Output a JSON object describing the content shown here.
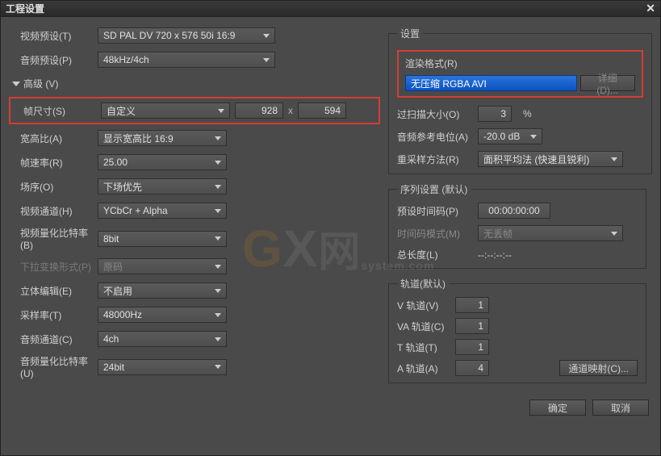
{
  "window": {
    "title": "工程设置"
  },
  "left": {
    "videoPreset": {
      "label": "视频预设(T)",
      "value": "SD PAL DV 720 x 576 50i 16:9"
    },
    "audioPreset": {
      "label": "音频预设(P)",
      "value": "48kHz/4ch"
    },
    "advanced": {
      "label": "高级 (V)"
    },
    "frameSize": {
      "label": "帧尺寸(S)",
      "value": "自定义",
      "w": "928",
      "sep": "x",
      "h": "594"
    },
    "aspect": {
      "label": "宽高比(A)",
      "value": "显示宽高比 16:9"
    },
    "frameRate": {
      "label": "帧速率(R)",
      "value": "25.00"
    },
    "fieldOrder": {
      "label": "场序(O)",
      "value": "下场优先"
    },
    "videoCh": {
      "label": "视频通道(H)",
      "value": "YCbCr + Alpha"
    },
    "videoBits": {
      "label": "视频量化比特率(B)",
      "value": "8bit"
    },
    "pulldown": {
      "label": "下拉变换形式(P)",
      "value": "原码"
    },
    "stereo": {
      "label": "立体编辑(E)",
      "value": "不启用"
    },
    "sampleRate": {
      "label": "采样率(T)",
      "value": "48000Hz"
    },
    "audioCh": {
      "label": "音频通道(C)",
      "value": "4ch"
    },
    "audioBits": {
      "label": "音频量化比特率(U)",
      "value": "24bit"
    }
  },
  "right": {
    "settings": {
      "legend": "设置",
      "renderFormat": {
        "label": "渲染格式(R)",
        "value": "无压缩 RGBA AVI",
        "detail": "详细(D)..."
      },
      "overscan": {
        "label": "过扫描大小(O)",
        "value": "3",
        "unit": "%"
      },
      "audioRef": {
        "label": "音频参考电位(A)",
        "value": "-20.0 dB"
      },
      "resample": {
        "label": "重采样方法(R)",
        "value": "面积平均法 (快速且锐利)"
      }
    },
    "seq": {
      "legend": "序列设置 (默认)",
      "presetTc": {
        "label": "预设时间码(P)",
        "value": "00:00:00:00"
      },
      "tcMode": {
        "label": "时间码模式(M)",
        "value": "无丢帧"
      },
      "totalLen": {
        "label": "总长度(L)",
        "value": "--:--:--:--"
      }
    },
    "tracks": {
      "legend": "轨道(默认)",
      "v": {
        "label": "V 轨道(V)",
        "value": "1"
      },
      "va": {
        "label": "VA 轨道(C)",
        "value": "1"
      },
      "t": {
        "label": "T 轨道(T)",
        "value": "1"
      },
      "a": {
        "label": "A 轨道(A)",
        "value": "4"
      },
      "mapBtn": "通道映射(C)..."
    }
  },
  "footer": {
    "ok": "确定",
    "cancel": "取消"
  },
  "watermark": {
    "g": "G",
    "x": "X",
    "net": "网",
    "sub": "system.com"
  }
}
